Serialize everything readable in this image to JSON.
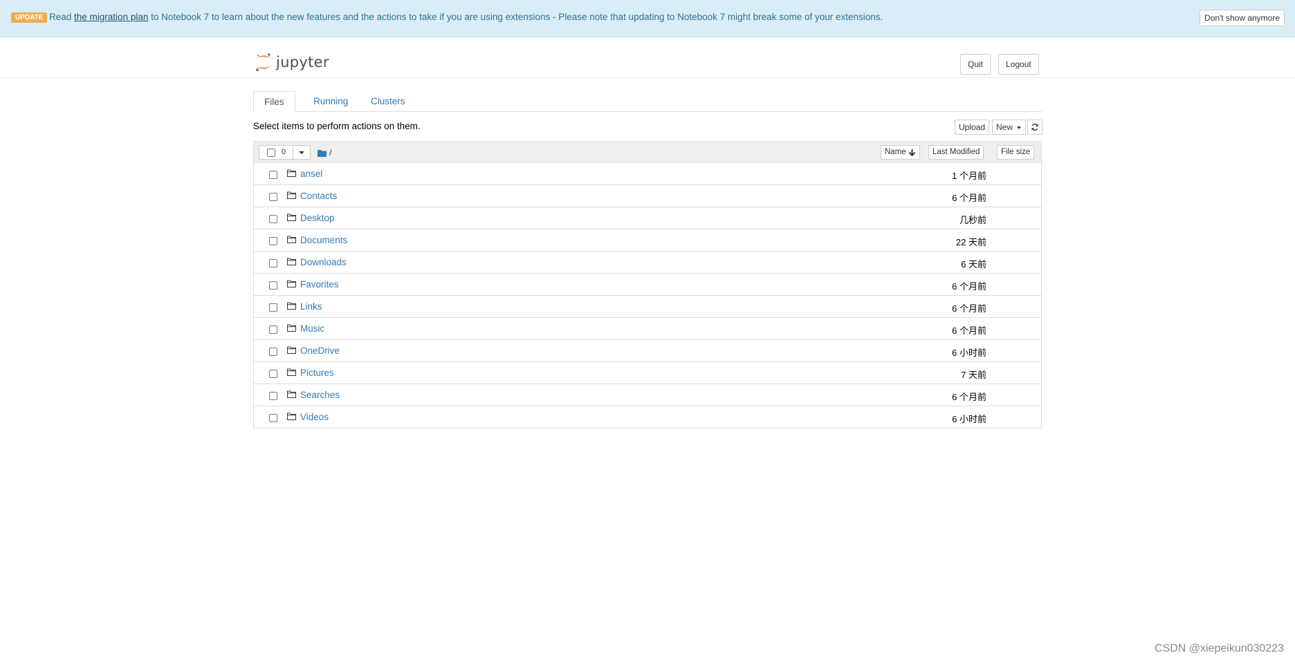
{
  "banner": {
    "badge": "UPDATE",
    "text_before": "Read ",
    "link": "the migration plan",
    "text_after": " to Notebook 7 to learn about the new features and the actions to take if you are using extensions - Please note that updating to Notebook 7 might break some of your extensions.",
    "dismiss": "Don't show anymore"
  },
  "header": {
    "logo_text": "jupyter",
    "quit": "Quit",
    "logout": "Logout"
  },
  "tabs": [
    {
      "label": "Files"
    },
    {
      "label": "Running"
    },
    {
      "label": "Clusters"
    }
  ],
  "toolbar": {
    "hint": "Select items to perform actions on them.",
    "upload": "Upload",
    "new": "New"
  },
  "list_header": {
    "selected_count": "0",
    "breadcrumb": "/",
    "name_col": "Name",
    "modified_col": "Last Modified",
    "size_col": "File size"
  },
  "files": [
    {
      "name": "ansel",
      "modified": "1 个月前"
    },
    {
      "name": "Contacts",
      "modified": "6 个月前"
    },
    {
      "name": "Desktop",
      "modified": "几秒前"
    },
    {
      "name": "Documents",
      "modified": "22 天前"
    },
    {
      "name": "Downloads",
      "modified": "6 天前"
    },
    {
      "name": "Favorites",
      "modified": "6 个月前"
    },
    {
      "name": "Links",
      "modified": "6 个月前"
    },
    {
      "name": "Music",
      "modified": "6 个月前"
    },
    {
      "name": "OneDrive",
      "modified": "6 小时前"
    },
    {
      "name": "Pictures",
      "modified": "7 天前"
    },
    {
      "name": "Searches",
      "modified": "6 个月前"
    },
    {
      "name": "Videos",
      "modified": "6 小时前"
    }
  ],
  "watermark": "CSDN @xiepeikun030223",
  "colors": {
    "banner_bg": "#d9edf7",
    "badge": "#f0ad4e",
    "link": "#337ab7",
    "jupyter_orange": "#f37726"
  }
}
